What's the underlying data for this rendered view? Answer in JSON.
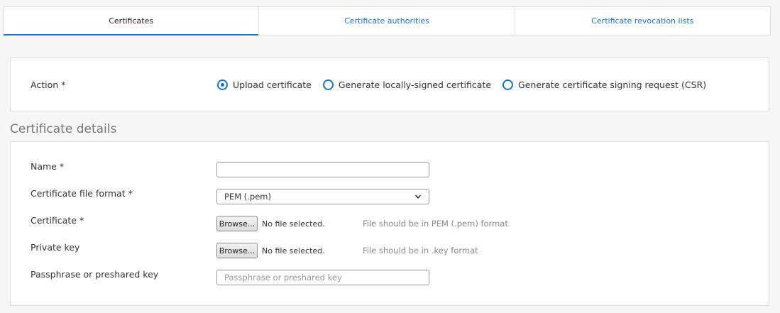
{
  "tabs": [
    {
      "label": "Certificates",
      "active": true
    },
    {
      "label": "Certificate authorities",
      "active": false
    },
    {
      "label": "Certificate revocation lists",
      "active": false
    }
  ],
  "action": {
    "label": "Action *",
    "options": [
      {
        "label": "Upload certificate",
        "checked": true
      },
      {
        "label": "Generate locally-signed certificate",
        "checked": false
      },
      {
        "label": "Generate certificate signing request (CSR)",
        "checked": false
      }
    ]
  },
  "details": {
    "title": "Certificate details",
    "name_label": "Name *",
    "name_value": "",
    "format_label": "Certificate file format *",
    "format_value": "PEM (.pem)",
    "certificate_label": "Certificate *",
    "certificate_browse": "Browse...",
    "certificate_file": "No file selected.",
    "certificate_hint": "File should be in PEM (.pem) format",
    "private_key_label": "Private key",
    "private_key_browse": "Browse...",
    "private_key_file": "No file selected.",
    "private_key_hint": "File should be in .key format",
    "passphrase_label": "Passphrase or preshared key",
    "passphrase_placeholder": "Passphrase or preshared key"
  },
  "colors": {
    "accent": "#1a73c8",
    "background": "#f7f7f7"
  }
}
